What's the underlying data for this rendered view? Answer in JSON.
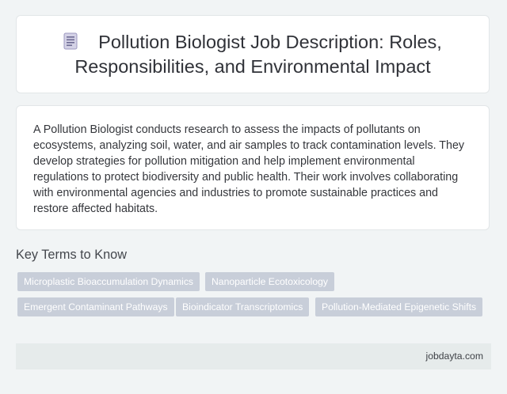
{
  "header": {
    "icon": "document-icon",
    "title": "Pollution Biologist Job Description: Roles, Responsibilities, and Environmental Impact"
  },
  "description": {
    "text": "A Pollution Biologist conducts research to assess the impacts of pollutants on ecosystems, analyzing soil, water, and air samples to track contamination levels. They develop strategies for pollution mitigation and help implement environmental regulations to protect biodiversity and public health. Their work involves collaborating with environmental agencies and industries to promote sustainable practices and restore affected habitats."
  },
  "key_terms": {
    "heading": "Key Terms to Know",
    "tags": [
      "Microplastic Bioaccumulation Dynamics",
      "Nanoparticle Ecotoxicology",
      "Emergent Contaminant Pathways",
      "Bioindicator Transcriptomics",
      "Pollution-Mediated Epigenetic Shifts"
    ]
  },
  "footer": {
    "site": "jobdayta.com"
  },
  "colors": {
    "page_bg": "#f1f4f5",
    "tag_bg": "#c8ced9",
    "footer_bg": "#e6ebeb"
  }
}
